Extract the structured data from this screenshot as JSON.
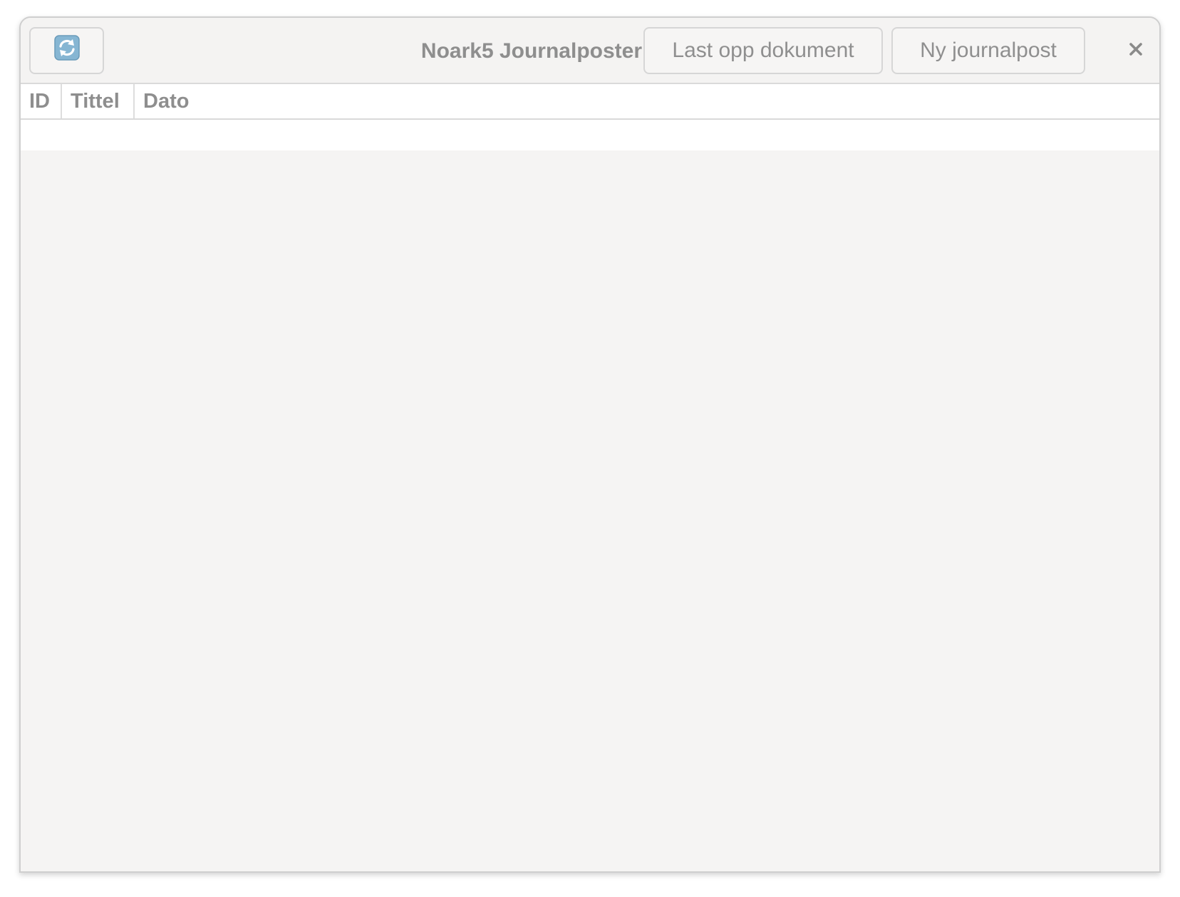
{
  "header": {
    "title": "Noark5 Journalposter",
    "refresh_icon": "refresh-icon",
    "upload_label": "Last opp dokument",
    "new_label": "Ny journalpost",
    "close_icon": "close-icon"
  },
  "table": {
    "columns": [
      "ID",
      "Tittel",
      "Dato"
    ],
    "rows": []
  },
  "colors": {
    "window_bg": "#f5f4f3",
    "text_muted": "#8e8e8e",
    "refresh_icon_bg": "#7fb1d0"
  }
}
